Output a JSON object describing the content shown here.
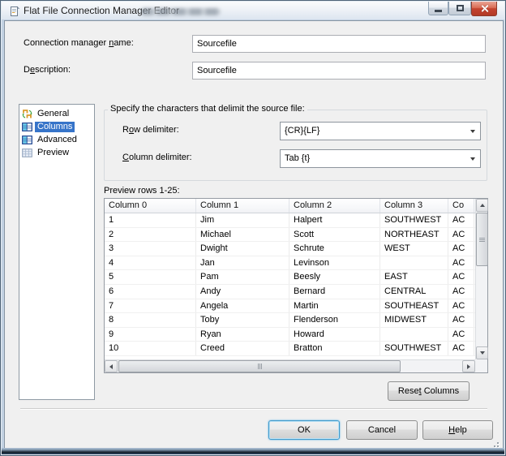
{
  "window": {
    "title": "Flat File Connection Manager Editor"
  },
  "fields": {
    "connection_manager_name": {
      "label": {
        "text": "Connection manager name:",
        "accel": 19
      },
      "value": "Sourcefile"
    },
    "description": {
      "label": {
        "text": "Description:",
        "accel": 1
      },
      "value": "Sourcefile"
    }
  },
  "sidebar": {
    "items": [
      {
        "label": "General",
        "selected": false
      },
      {
        "label": "Columns",
        "selected": true
      },
      {
        "label": "Advanced",
        "selected": false
      },
      {
        "label": "Preview",
        "selected": false
      }
    ]
  },
  "delimiters": {
    "group_title": "Specify the characters that delimit the source file:",
    "row_delimiter": {
      "label": {
        "text": "Row delimiter:",
        "accel": 1
      },
      "value": "{CR}{LF}"
    },
    "column_delimiter": {
      "label": {
        "text": "Column delimiter:",
        "accel": 0
      },
      "value": "Tab {t}"
    }
  },
  "preview": {
    "label": "Preview rows 1-25:",
    "columns": [
      "Column 0",
      "Column 1",
      "Column 2",
      "Column 3",
      "Co"
    ],
    "rows": [
      [
        "1",
        "Jim",
        "Halpert",
        "SOUTHWEST",
        "AC"
      ],
      [
        "2",
        "Michael",
        "Scott",
        "NORTHEAST",
        "AC"
      ],
      [
        "3",
        "Dwight",
        "Schrute",
        "WEST",
        "AC"
      ],
      [
        "4",
        "Jan",
        "Levinson",
        "",
        "AC"
      ],
      [
        "5",
        "Pam",
        "Beesly",
        "EAST",
        "AC"
      ],
      [
        "6",
        "Andy",
        "Bernard",
        "CENTRAL",
        "AC"
      ],
      [
        "7",
        "Angela",
        "Martin",
        "SOUTHEAST",
        "AC"
      ],
      [
        "8",
        "Toby",
        "Flenderson",
        "MIDWEST",
        "AC"
      ],
      [
        "9",
        "Ryan",
        "Howard",
        "",
        "AC"
      ],
      [
        "10",
        "Creed",
        "Bratton",
        "SOUTHWEST",
        "AC"
      ]
    ]
  },
  "buttons": {
    "reset_columns": {
      "text": "Reset Columns",
      "accel": 4
    },
    "ok": {
      "text": "OK",
      "accel": -1
    },
    "cancel": {
      "text": "Cancel",
      "accel": -1
    },
    "help": {
      "text": "Help",
      "accel": 0
    }
  },
  "colors": {
    "selection_blue": "#3674c9",
    "close_button_red": "#c44430",
    "ok_focus_border": "#3f9bcc"
  }
}
